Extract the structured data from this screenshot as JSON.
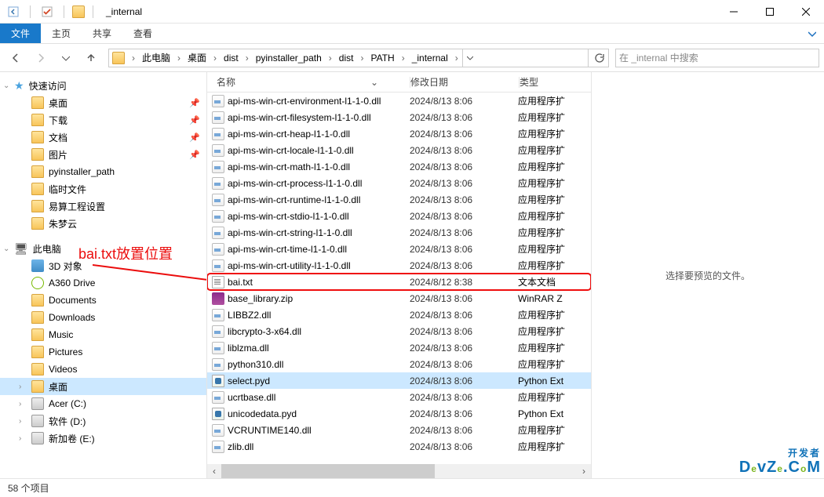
{
  "window": {
    "title": "_internal",
    "min": "—",
    "max": "☐",
    "close": "✕"
  },
  "ribbon": {
    "file": "文件",
    "home": "主页",
    "share": "共享",
    "view": "查看"
  },
  "breadcrumb": {
    "segs": [
      "此电脑",
      "桌面",
      "dist",
      "pyinstaller_path",
      "dist",
      "PATH",
      "_internal"
    ]
  },
  "search": {
    "placeholder": "在 _internal 中搜索"
  },
  "sidebar": {
    "quick": "快速访问",
    "items": [
      {
        "label": "桌面",
        "icon": "folder",
        "pin": true
      },
      {
        "label": "下载",
        "icon": "folder",
        "pin": true
      },
      {
        "label": "文档",
        "icon": "folder",
        "pin": true
      },
      {
        "label": "图片",
        "icon": "folder",
        "pin": true
      },
      {
        "label": "pyinstaller_path",
        "icon": "folder"
      },
      {
        "label": "临时文件",
        "icon": "folder"
      },
      {
        "label": "易算工程设置",
        "icon": "folder"
      },
      {
        "label": "朱梦云",
        "icon": "folder"
      }
    ],
    "thispc": "此电脑",
    "pc_items": [
      {
        "label": "3D 对象",
        "icon": "cube"
      },
      {
        "label": "A360 Drive",
        "icon": "cloud"
      },
      {
        "label": "Documents",
        "icon": "folder"
      },
      {
        "label": "Downloads",
        "icon": "folder"
      },
      {
        "label": "Music",
        "icon": "folder"
      },
      {
        "label": "Pictures",
        "icon": "folder"
      },
      {
        "label": "Videos",
        "icon": "folder"
      },
      {
        "label": "桌面",
        "icon": "folder",
        "selected": true
      },
      {
        "label": "Acer (C:)",
        "icon": "drive"
      },
      {
        "label": "软件 (D:)",
        "icon": "drive"
      },
      {
        "label": "新加卷 (E:)",
        "icon": "drive"
      }
    ]
  },
  "annotation": "bai.txt放置位置",
  "columns": {
    "name": "名称",
    "date": "修改日期",
    "type": "类型"
  },
  "files": [
    {
      "name": "api-ms-win-crt-environment-l1-1-0.dll",
      "date": "2024/8/13 8:06",
      "type": "应用程序扩",
      "icon": "dll"
    },
    {
      "name": "api-ms-win-crt-filesystem-l1-1-0.dll",
      "date": "2024/8/13 8:06",
      "type": "应用程序扩",
      "icon": "dll"
    },
    {
      "name": "api-ms-win-crt-heap-l1-1-0.dll",
      "date": "2024/8/13 8:06",
      "type": "应用程序扩",
      "icon": "dll"
    },
    {
      "name": "api-ms-win-crt-locale-l1-1-0.dll",
      "date": "2024/8/13 8:06",
      "type": "应用程序扩",
      "icon": "dll"
    },
    {
      "name": "api-ms-win-crt-math-l1-1-0.dll",
      "date": "2024/8/13 8:06",
      "type": "应用程序扩",
      "icon": "dll"
    },
    {
      "name": "api-ms-win-crt-process-l1-1-0.dll",
      "date": "2024/8/13 8:06",
      "type": "应用程序扩",
      "icon": "dll"
    },
    {
      "name": "api-ms-win-crt-runtime-l1-1-0.dll",
      "date": "2024/8/13 8:06",
      "type": "应用程序扩",
      "icon": "dll"
    },
    {
      "name": "api-ms-win-crt-stdio-l1-1-0.dll",
      "date": "2024/8/13 8:06",
      "type": "应用程序扩",
      "icon": "dll"
    },
    {
      "name": "api-ms-win-crt-string-l1-1-0.dll",
      "date": "2024/8/13 8:06",
      "type": "应用程序扩",
      "icon": "dll"
    },
    {
      "name": "api-ms-win-crt-time-l1-1-0.dll",
      "date": "2024/8/13 8:06",
      "type": "应用程序扩",
      "icon": "dll"
    },
    {
      "name": "api-ms-win-crt-utility-l1-1-0.dll",
      "date": "2024/8/13 8:06",
      "type": "应用程序扩",
      "icon": "dll"
    },
    {
      "name": "bai.txt",
      "date": "2024/8/12 8:38",
      "type": "文本文档",
      "icon": "txt",
      "highlighted": true
    },
    {
      "name": "base_library.zip",
      "date": "2024/8/13 8:06",
      "type": "WinRAR Z",
      "icon": "zip"
    },
    {
      "name": "LIBBZ2.dll",
      "date": "2024/8/13 8:06",
      "type": "应用程序扩",
      "icon": "dll"
    },
    {
      "name": "libcrypto-3-x64.dll",
      "date": "2024/8/13 8:06",
      "type": "应用程序扩",
      "icon": "dll"
    },
    {
      "name": "liblzma.dll",
      "date": "2024/8/13 8:06",
      "type": "应用程序扩",
      "icon": "dll"
    },
    {
      "name": "python310.dll",
      "date": "2024/8/13 8:06",
      "type": "应用程序扩",
      "icon": "dll"
    },
    {
      "name": "select.pyd",
      "date": "2024/8/13 8:06",
      "type": "Python Ext",
      "icon": "pyd",
      "selected": true
    },
    {
      "name": "ucrtbase.dll",
      "date": "2024/8/13 8:06",
      "type": "应用程序扩",
      "icon": "dll"
    },
    {
      "name": "unicodedata.pyd",
      "date": "2024/8/13 8:06",
      "type": "Python Ext",
      "icon": "pyd"
    },
    {
      "name": "VCRUNTIME140.dll",
      "date": "2024/8/13 8:06",
      "type": "应用程序扩",
      "icon": "dll"
    },
    {
      "name": "zlib.dll",
      "date": "2024/8/13 8:06",
      "type": "应用程序扩",
      "icon": "dll"
    }
  ],
  "preview_text": "选择要预览的文件。",
  "status": "58 个项目",
  "watermark": {
    "l1": "开发者",
    "l2": "DevZe.CoM"
  }
}
